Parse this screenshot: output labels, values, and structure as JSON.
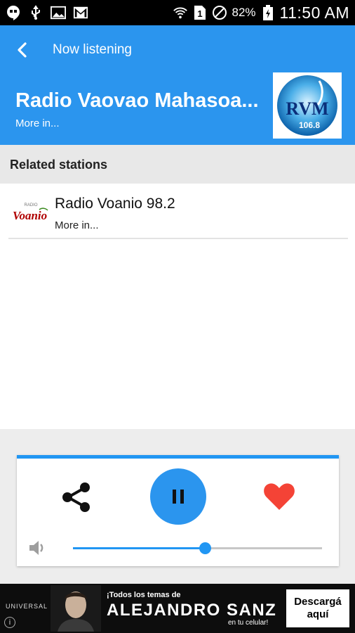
{
  "status_bar": {
    "battery_pct": "82%",
    "time": "11:50 AM",
    "icons": [
      "hangouts-icon",
      "usb-icon",
      "image-icon",
      "gmail-icon",
      "wifi-icon",
      "sim-1-icon",
      "do-not-disturb-icon",
      "battery-charging-icon"
    ]
  },
  "header": {
    "title": "Now listening",
    "station_name": "Radio Vaovao Mahasoa...",
    "more_label": "More in...",
    "logo_text": "RVM",
    "logo_sub": "106.8",
    "bg_color": "#2b95ee"
  },
  "related": {
    "title": "Related stations",
    "items": [
      {
        "name": "Radio Voanio 98.2",
        "more": "More in...",
        "logo_text": "Voanio"
      }
    ]
  },
  "player": {
    "state": "playing",
    "volume_fraction": 0.53,
    "accent_color": "#2196f3",
    "heart_color": "#f44336"
  },
  "ad": {
    "brand": "UNIVERSAL",
    "line1": "¡Todos los temas de",
    "headline": "ALEJANDRO SANZ",
    "line3": "en tu celular!",
    "cta": "Descargá aquí",
    "info": "i"
  }
}
